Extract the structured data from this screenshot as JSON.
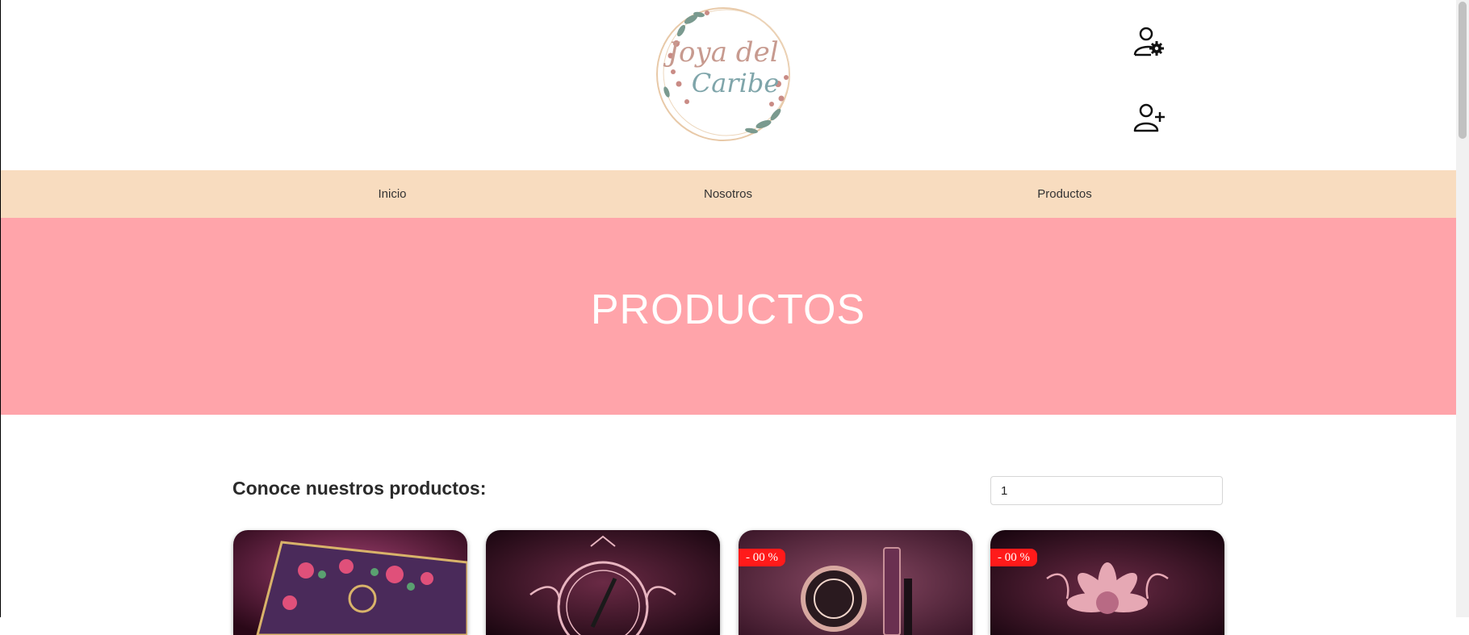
{
  "brand": {
    "line1": "Joya del",
    "line2": "Caribe"
  },
  "header": {
    "settings_icon": "user-settings-icon",
    "register_icon": "user-plus-icon"
  },
  "nav": {
    "items": [
      {
        "label": "Inicio"
      },
      {
        "label": "Nosotros"
      },
      {
        "label": "Productos"
      }
    ]
  },
  "hero": {
    "title": "PRODUCTOS"
  },
  "products": {
    "heading": "Conoce nuestros productos:",
    "page_input_value": "1",
    "cards": [
      {
        "image": "floral-palette-box",
        "badge": ""
      },
      {
        "image": "ornate-brush-emblem",
        "badge": ""
      },
      {
        "image": "mascara-emblem",
        "badge": "- 00 %"
      },
      {
        "image": "lotus-emblem",
        "badge": "- 00 %"
      }
    ]
  },
  "colors": {
    "nav_bg": "#f8dcbf",
    "hero_bg": "#ffa4aa",
    "badge": "#ff1a1a"
  }
}
